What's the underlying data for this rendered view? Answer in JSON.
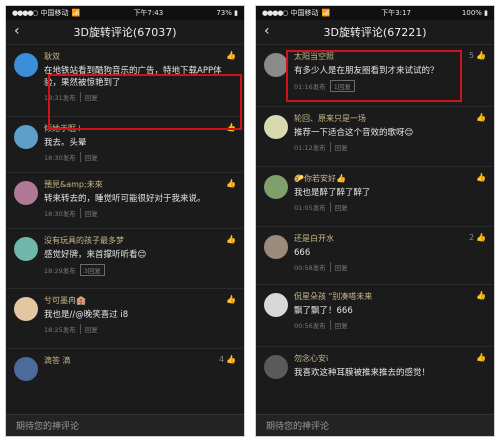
{
  "left": {
    "status": {
      "carrier": "中国移动",
      "time": "下午7:43",
      "battery": "73%"
    },
    "title": "3D旋转评论(67037)",
    "comments": [
      {
        "user": "耿双",
        "likes": "",
        "text": "在地铁站看到酷狗音乐的广告，特地下载APP体验，果然被惊艳到了",
        "time": "18:31发布",
        "reply": "回复",
        "avatar_color": "#3a8fd8"
      },
      {
        "user": "倾她于眠 i",
        "likes": "",
        "text": "我去。头晕",
        "time": "18:30发布",
        "reply": "回复",
        "avatar_color": "#5d9fc9"
      },
      {
        "user": "預見&amp;未來",
        "likes": "",
        "text": "转来转去的，睡觉听可能很好对于我来说。",
        "time": "18:30发布",
        "reply": "回复",
        "avatar_color": "#b07a96"
      },
      {
        "user": "没有玩具的孩子最多梦",
        "likes": "",
        "text": "感觉好牌，来首撑听听看😊",
        "time": "18:29发布",
        "reply": "3回复",
        "avatar_color": "#6fb7a8"
      },
      {
        "user": "兮可墨冉🏨",
        "likes": "",
        "text": "我也是//@晚笑喜过 i8",
        "time": "18:25发布",
        "reply": "回复",
        "avatar_color": "#e3c7a0"
      },
      {
        "user": "滴答 滴",
        "likes": "4",
        "text": "",
        "time": "",
        "reply": "",
        "avatar_color": "#4b6b9a"
      }
    ],
    "input_placeholder": "期待您的神评论"
  },
  "right": {
    "status": {
      "carrier": "中国移动",
      "time": "下午3:17",
      "battery": "100%"
    },
    "title": "3D旋转评论(67221)",
    "comments": [
      {
        "user": "太阳当空照",
        "likes": "5",
        "text": "有多少人是在朋友圈看到才来试试的？",
        "time": "01:16发布",
        "reply": "1回复",
        "avatar_color": "#8a8a8a"
      },
      {
        "user": "轮回、原来只是一场",
        "likes": "",
        "text": "推荐一下适合这个音效的歌呀😊",
        "time": "01:12发布",
        "reply": "回复",
        "avatar_color": "#d9d9b0"
      },
      {
        "user": "🌮你若安好👍",
        "likes": "",
        "text": "我也是醉了醉了醉了",
        "time": "01:05发布",
        "reply": "回复",
        "avatar_color": "#7fa06a"
      },
      {
        "user": "还是白开水",
        "likes": "2",
        "text": "666",
        "time": "00:58发布",
        "reply": "回复",
        "avatar_color": "#9c8a7a"
      },
      {
        "user": "侃星朵孩 \"别凑嗒未来",
        "likes": "",
        "text": "飘了飘了！666",
        "time": "00:56发布",
        "reply": "回复",
        "avatar_color": "#d8d8d8"
      },
      {
        "user": "勿念心安i",
        "likes": "",
        "text": "我喜欢这种耳膜被推来推去的感觉！",
        "time": "",
        "reply": "",
        "avatar_color": "#5a5a5a"
      }
    ],
    "input_placeholder": "期待您的神评论"
  }
}
